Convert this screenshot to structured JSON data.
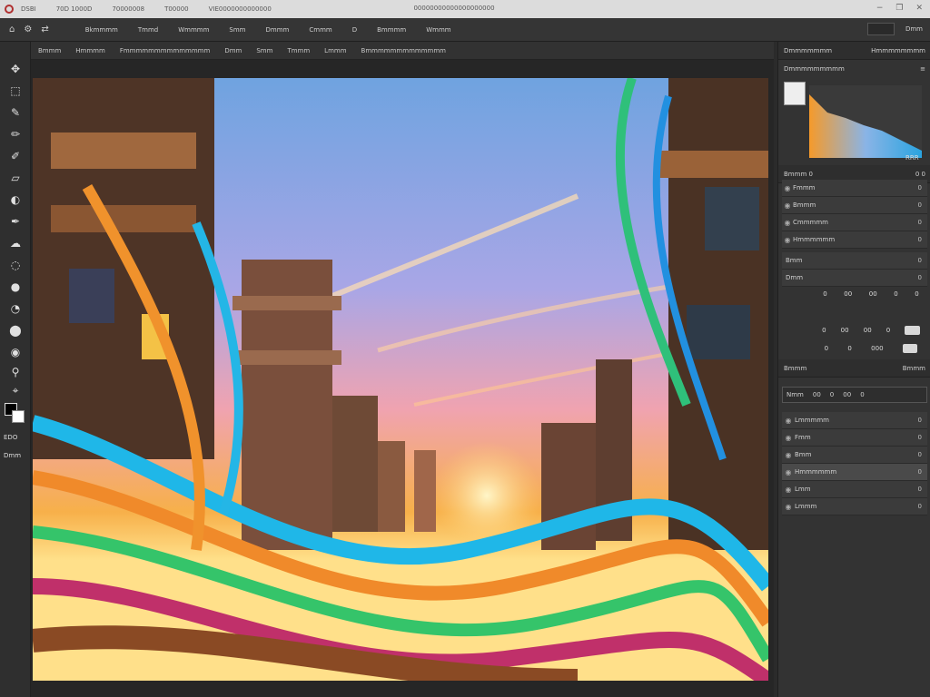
{
  "titlebar": {
    "menu": [
      "DSBI",
      "70D 1000D",
      "70000008",
      "T00000",
      "VIE0000000000000"
    ],
    "document_title": "00000000000000000000"
  },
  "options": {
    "items": [
      "Bkmmmm",
      "Tmmd",
      "Wmmmm",
      "Smm",
      "Dmmm",
      "Cmmm",
      "D",
      "Bmmmm",
      "Wmmm"
    ],
    "right_label": "Dmm"
  },
  "tabs": [
    "Bmmm",
    "Hmmmm",
    "Fmmmmmmmmmmmmmm",
    "Dmm",
    "Smm",
    "Tmmm",
    "Lmmm",
    "Bmmmmmmmmmmmmm"
  ],
  "toolbar": {
    "label_1": "EDO",
    "label_2": "Dmm"
  },
  "panel": {
    "histogram_title": "Dmmmmmmm",
    "histogram_right": "Hmmmmmmmm",
    "histogram_sub": "Dmmmmmmmmm",
    "histogram_value": "RRR",
    "properties_title": "Bmmm 0",
    "properties_right": "0 0",
    "props": [
      {
        "label": "Fmmm",
        "val": "0"
      },
      {
        "label": "Bmmm",
        "val": "0"
      },
      {
        "label": "Cmmmmm",
        "val": "0"
      },
      {
        "label": "Hmmmmmm",
        "val": "0"
      }
    ],
    "adjust_1_label": "Bmm",
    "adjust_1_val": "0",
    "adjust_2_label": "Dmm",
    "adjust_2_val": "0",
    "btnrow_1": [
      "0",
      "00",
      "00",
      "0",
      "0"
    ],
    "btnrow_2": [
      "0",
      "00",
      "00",
      "0"
    ],
    "btnrow_3": [
      "0",
      "0",
      "000"
    ],
    "layers_title": "Bmmm",
    "layers_right": "Bmmm",
    "input_fields": [
      "Nmm",
      "00",
      "0",
      "00",
      "0"
    ],
    "layers": [
      {
        "label": "Lmmmmm",
        "val": "0",
        "selected": false
      },
      {
        "label": "Fmm",
        "val": "0",
        "selected": false
      },
      {
        "label": "Bmm",
        "val": "0",
        "selected": false
      },
      {
        "label": "Hmmmmmm",
        "val": "0",
        "selected": true
      },
      {
        "label": "Lmm",
        "val": "0",
        "selected": false
      },
      {
        "label": "Lmmm",
        "val": "0",
        "selected": false
      }
    ]
  },
  "colors": {
    "sky_top": "#6fa3e0",
    "sunset": "#f7b04a",
    "panel_bg": "#333333",
    "accent_red": "#b03030"
  }
}
